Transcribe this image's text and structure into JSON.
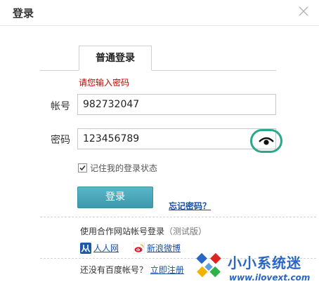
{
  "dialog": {
    "title": "登录"
  },
  "tabs": [
    {
      "label": "普通登录",
      "active": true
    }
  ],
  "form": {
    "error": "请您输入密码",
    "account_label": "帐号",
    "account_value": "982732047",
    "password_label": "密码",
    "password_value": "123456789",
    "remember_label": "记住我的登录状态",
    "remember_checked": true,
    "login_button": "登录",
    "forgot_link": "忘记密码？"
  },
  "partners": {
    "title": "使用合作网站帐号登录",
    "note": "（测试版）",
    "items": [
      {
        "label": "人人网",
        "icon": "renren-icon"
      },
      {
        "label": "新浪微博",
        "icon": "weibo-icon"
      }
    ]
  },
  "footer": {
    "no_account": "还没有百度帐号？",
    "register_link": "立即注册"
  },
  "watermark": {
    "text": "小小系统迷",
    "url": "www.ilovext.com"
  },
  "colors": {
    "button": "#4aa6ba",
    "error": "#c00000",
    "link": "#1a4fa8",
    "highlight_circle": "#2aa889"
  }
}
